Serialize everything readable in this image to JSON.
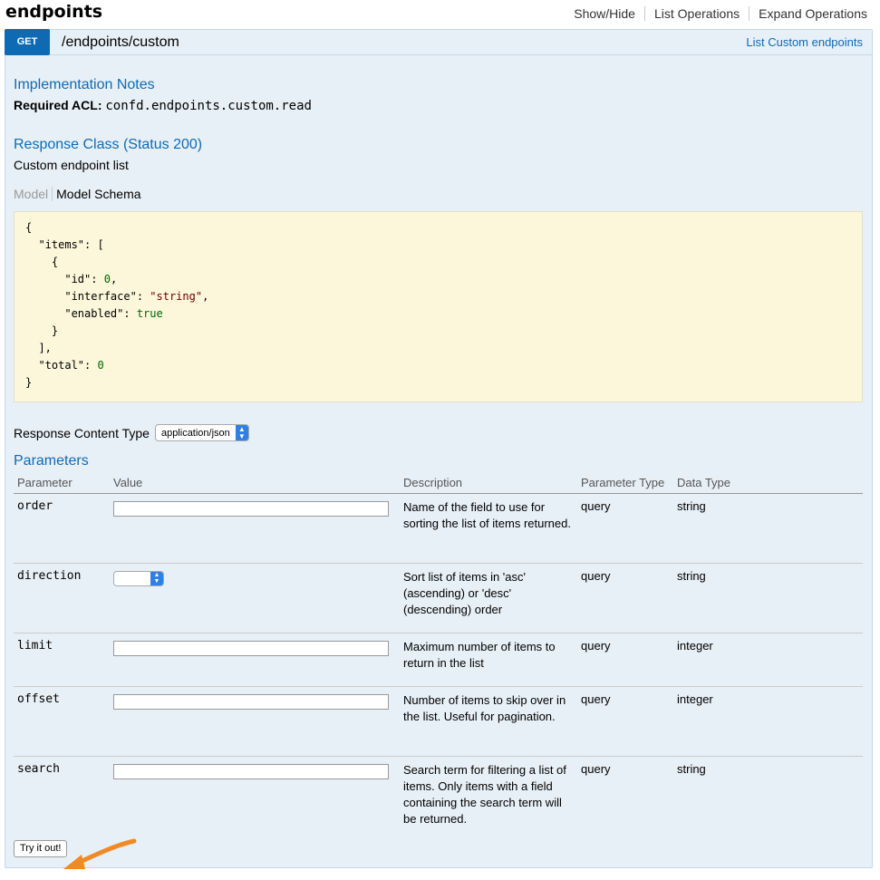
{
  "header": {
    "title": "endpoints",
    "links": [
      "Show/Hide",
      "List Operations",
      "Expand Operations"
    ]
  },
  "operation": {
    "method": "GET",
    "path": "/endpoints/custom",
    "summary": "List Custom endpoints",
    "implementation_notes_title": "Implementation Notes",
    "acl_label": "Required ACL:",
    "acl_value": "confd.endpoints.custom.read",
    "response_class_title": "Response Class (Status 200)",
    "response_description": "Custom endpoint list",
    "model_tabs": [
      "Model",
      "Model Schema"
    ],
    "schema_lines": [
      "{",
      "  \"items\": [",
      "    {",
      "      \"id\": 0,",
      "      \"interface\": \"string\",",
      "      \"enabled\": true",
      "    }",
      "  ],",
      "  \"total\": 0",
      "}"
    ],
    "response_content_type_label": "Response Content Type",
    "response_content_type_value": "application/json",
    "parameters_title": "Parameters",
    "parameter_headers": [
      "Parameter",
      "Value",
      "Description",
      "Parameter Type",
      "Data Type"
    ],
    "parameters": [
      {
        "name": "order",
        "control": "input",
        "description": "Name of the field to use for sorting the list of items returned.",
        "param_type": "query",
        "data_type": "string"
      },
      {
        "name": "direction",
        "control": "select",
        "description": "Sort list of items in 'asc' (ascending) or 'desc' (descending) order",
        "param_type": "query",
        "data_type": "string"
      },
      {
        "name": "limit",
        "control": "input",
        "description": "Maximum number of items to return in the list",
        "param_type": "query",
        "data_type": "integer"
      },
      {
        "name": "offset",
        "control": "input",
        "description": "Number of items to skip over in the list. Useful for pagination.",
        "param_type": "query",
        "data_type": "integer"
      },
      {
        "name": "search",
        "control": "input",
        "description": "Search term for filtering a list of items. Only items with a field containing the search term will be returned.",
        "param_type": "query",
        "data_type": "string"
      }
    ],
    "try_button": "Try it out!"
  },
  "colors": {
    "accent": "#0f6ab4",
    "panel_bg": "#e7f0f7",
    "schema_bg": "#fcf6db",
    "arrow": "#f08a24"
  }
}
